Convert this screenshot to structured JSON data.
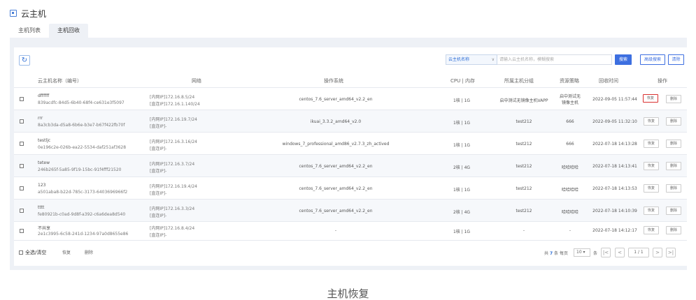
{
  "header": {
    "icon": "server-icon",
    "title": "云主机"
  },
  "tabs": [
    {
      "label": "主机列表",
      "active": false
    },
    {
      "label": "主机回收",
      "active": true
    }
  ],
  "toolbar": {
    "refresh_icon": "refresh-icon",
    "search_field_select": "云主机名称",
    "search_placeholder": "请输入云主机名称，模糊搜索",
    "search_label": "搜索",
    "advanced_label": "高级搜索",
    "clear_label": "清除"
  },
  "table": {
    "headers": [
      "云主机名称（编号）",
      "网络",
      "操作系统",
      "CPU | 内存",
      "所属主机分组",
      "资源策略",
      "回收时间",
      "操作"
    ],
    "rows": [
      {
        "name": "dffffff",
        "id": "839acdfc-84d5-6b40-68f4-ce631e3f5097",
        "net1": "[内网IP]172.16.8.5/24",
        "net2": "[直连IP]172.16.1.140/24",
        "os": "centos_7.6_server_amd64_v2.2_en",
        "cpu_mem": "1核 | 1G",
        "group": "启中测试无镜像主机VAPP",
        "policy_l1": "启中测试无",
        "policy_l2": "镜像主机",
        "time": "2022-09-05 11:57:44",
        "restore": "恢复",
        "delete": "删除"
      },
      {
        "name": "rrr",
        "id": "8a3cb3da-d5a8-6b6e-b3e7-b67f422fb70f",
        "net1": "[内网IP]172.16.19.7/24",
        "net2": "[直连IP]-",
        "os": "ikuai_3.3.2_amd64_v2.0",
        "cpu_mem": "1核 | 1G",
        "group": "test212",
        "policy_l1": "666",
        "policy_l2": "",
        "time": "2022-09-05 11:32:10",
        "restore": "恢复",
        "delete": "删除"
      },
      {
        "name": "testljc",
        "id": "0e196c2e-026b-ea22-5534-daf251af3628",
        "net1": "[内网IP]172.16.3.16/24",
        "net2": "[直连IP]-",
        "os": "windows_7_professional_amd86_v2.7.3_zh_actived",
        "cpu_mem": "1核 | 1G",
        "group": "test212",
        "policy_l1": "666",
        "policy_l2": "",
        "time": "2022-07-18 14:13:28",
        "restore": "恢复",
        "delete": "删除"
      },
      {
        "name": "tetew",
        "id": "246b265f-5a85-9f19-15bc-91f4fff21520",
        "net1": "[内网IP]172.16.3.7/24",
        "net2": "[直连IP]-",
        "os": "centos_7.6_server_amd64_v2.2_en",
        "cpu_mem": "2核 | 4G",
        "group": "test212",
        "policy_l1": "哈哈哈哈",
        "policy_l2": "",
        "time": "2022-07-18 14:13:41",
        "restore": "恢复",
        "delete": "删除"
      },
      {
        "name": "123",
        "id": "a501aba8-b22d-785c-3173-6403696966f2",
        "net1": "[内网IP]172.16.19.4/24",
        "net2": "[直连IP]-",
        "os": "centos_7.6_server_amd64_v2.2_en",
        "cpu_mem": "1核 | 1G",
        "group": "test212",
        "policy_l1": "哈哈哈哈",
        "policy_l2": "",
        "time": "2022-07-18 14:13:53",
        "restore": "恢复",
        "delete": "删除"
      },
      {
        "name": "tttt",
        "id": "fe80921b-c0ad-9d8f-a392-c6a6dea8d540",
        "net1": "[内网IP]172.16.3.3/24",
        "net2": "[直连IP]-",
        "os": "centos_7.6_server_amd64_v2.2_en",
        "cpu_mem": "2核 | 4G",
        "group": "test212",
        "policy_l1": "哈哈哈哈",
        "policy_l2": "",
        "time": "2022-07-18 14:10:39",
        "restore": "恢复",
        "delete": "删除"
      },
      {
        "name": "不共享",
        "id": "2e1c3995-6c58-241d-1234-97a0d8655e86",
        "net1": "[内网IP]172.16.8.4/24",
        "net2": "[直连IP]-",
        "os": "-",
        "cpu_mem": "1核 | 1G",
        "group": "-",
        "policy_l1": "-",
        "policy_l2": "",
        "time": "2022-07-18 14:12:17",
        "restore": "恢复",
        "delete": "删除"
      }
    ]
  },
  "footer": {
    "select_all": "全选/清空",
    "restore": "恢复",
    "delete": "删除",
    "total_prefix": "共",
    "total": "7",
    "total_suffix": "条 每页",
    "page_size": "10",
    "page_size_suffix": "条",
    "page_indicator": "1 / 1"
  },
  "caption": "主机恢复"
}
